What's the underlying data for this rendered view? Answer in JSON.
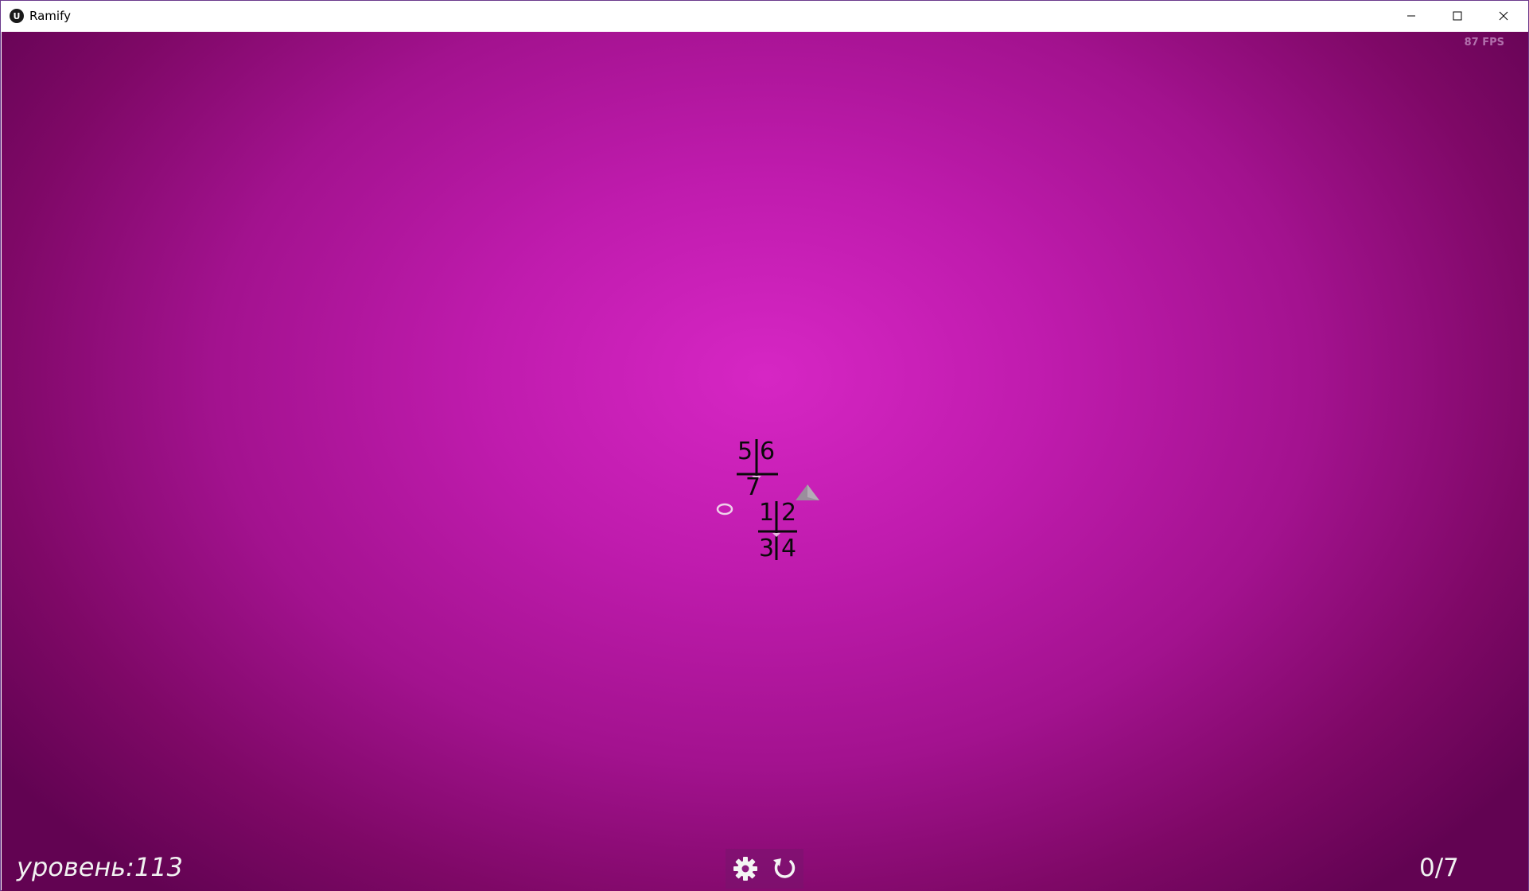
{
  "window": {
    "title": "Ramify",
    "icon": "unreal-engine-logo-icon",
    "controls": [
      "minimize-icon",
      "maximize-icon",
      "close-icon"
    ]
  },
  "hud": {
    "fps": "87 FPS",
    "level": "уровень:113",
    "progress": "0/7"
  },
  "board": {
    "upper_cell": {
      "labels": [
        "5",
        "6",
        "7"
      ]
    },
    "lower_cell": {
      "labels": [
        "1",
        "2",
        "3",
        "4"
      ]
    },
    "markers": [
      "ring-marker",
      "triangle-marker"
    ]
  },
  "toolbar": {
    "settings_icon": "gear-icon",
    "restart_icon": "restart-icon"
  },
  "colors": {
    "bg_center": "#d626c4",
    "bg_edge": "#620352",
    "text_light": "#f1f1f1",
    "lines": "#0a0a0a"
  }
}
